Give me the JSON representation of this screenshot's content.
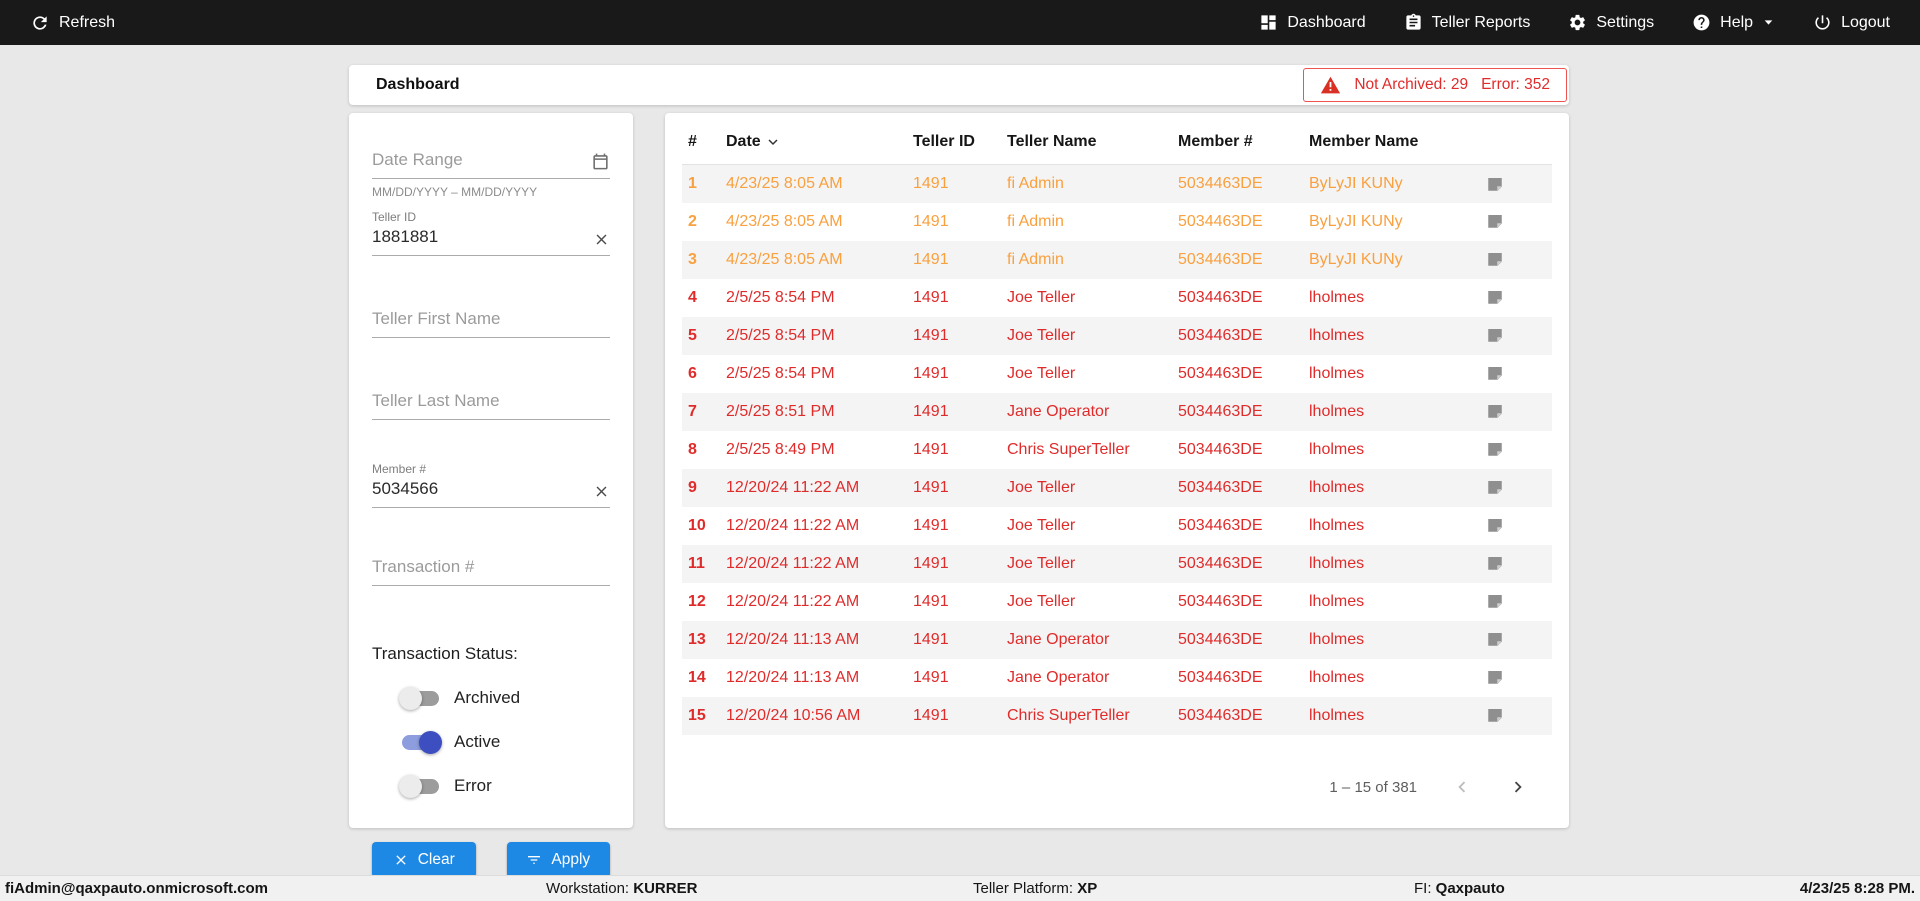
{
  "topnav": {
    "refresh_label": "Refresh",
    "dashboard": "Dashboard",
    "teller_reports": "Teller Reports",
    "settings": "Settings",
    "help": "Help",
    "logout": "Logout"
  },
  "header": {
    "title": "Dashboard",
    "alert": {
      "not_archived": "Not Archived: 29",
      "error": "Error: 352"
    }
  },
  "filters": {
    "date_range": {
      "placeholder": "Date Range",
      "hint": "MM/DD/YYYY – MM/DD/YYYY"
    },
    "teller_id": {
      "label": "Teller ID",
      "value": "1881881"
    },
    "teller_first_name": {
      "placeholder": "Teller First Name"
    },
    "teller_last_name": {
      "placeholder": "Teller Last Name"
    },
    "member_number": {
      "label": "Member #",
      "value": "5034566"
    },
    "transaction_number": {
      "placeholder": "Transaction #"
    },
    "status_label": "Transaction Status:",
    "toggles": [
      {
        "label": "Archived",
        "on": false
      },
      {
        "label": "Active",
        "on": true
      },
      {
        "label": "Error",
        "on": false
      }
    ],
    "clear_label": "Clear",
    "apply_label": "Apply"
  },
  "table": {
    "columns": [
      "#",
      "Date",
      "Teller ID",
      "Teller Name",
      "Member #",
      "Member Name"
    ],
    "sort_column": "Date",
    "sort_direction": "desc",
    "rows": [
      {
        "num": "1",
        "date": "4/23/25 8:05 AM",
        "teller_id": "1491",
        "teller_name": "fi Admin",
        "member": "5034463DE",
        "member_name": "ByLyJI KUNy",
        "status": "warning"
      },
      {
        "num": "2",
        "date": "4/23/25 8:05 AM",
        "teller_id": "1491",
        "teller_name": "fi Admin",
        "member": "5034463DE",
        "member_name": "ByLyJI KUNy",
        "status": "warning"
      },
      {
        "num": "3",
        "date": "4/23/25 8:05 AM",
        "teller_id": "1491",
        "teller_name": "fi Admin",
        "member": "5034463DE",
        "member_name": "ByLyJI KUNy",
        "status": "warning"
      },
      {
        "num": "4",
        "date": "2/5/25 8:54 PM",
        "teller_id": "1491",
        "teller_name": "Joe Teller",
        "member": "5034463DE",
        "member_name": "lholmes",
        "status": "error"
      },
      {
        "num": "5",
        "date": "2/5/25 8:54 PM",
        "teller_id": "1491",
        "teller_name": "Joe Teller",
        "member": "5034463DE",
        "member_name": "lholmes",
        "status": "error"
      },
      {
        "num": "6",
        "date": "2/5/25 8:54 PM",
        "teller_id": "1491",
        "teller_name": "Joe Teller",
        "member": "5034463DE",
        "member_name": "lholmes",
        "status": "error"
      },
      {
        "num": "7",
        "date": "2/5/25 8:51 PM",
        "teller_id": "1491",
        "teller_name": "Jane Operator",
        "member": "5034463DE",
        "member_name": "lholmes",
        "status": "error"
      },
      {
        "num": "8",
        "date": "2/5/25 8:49 PM",
        "teller_id": "1491",
        "teller_name": "Chris SuperTeller",
        "member": "5034463DE",
        "member_name": "lholmes",
        "status": "error"
      },
      {
        "num": "9",
        "date": "12/20/24 11:22 AM",
        "teller_id": "1491",
        "teller_name": "Joe Teller",
        "member": "5034463DE",
        "member_name": "lholmes",
        "status": "error"
      },
      {
        "num": "10",
        "date": "12/20/24 11:22 AM",
        "teller_id": "1491",
        "teller_name": "Joe Teller",
        "member": "5034463DE",
        "member_name": "lholmes",
        "status": "error"
      },
      {
        "num": "11",
        "date": "12/20/24 11:22 AM",
        "teller_id": "1491",
        "teller_name": "Joe Teller",
        "member": "5034463DE",
        "member_name": "lholmes",
        "status": "error"
      },
      {
        "num": "12",
        "date": "12/20/24 11:22 AM",
        "teller_id": "1491",
        "teller_name": "Joe Teller",
        "member": "5034463DE",
        "member_name": "lholmes",
        "status": "error"
      },
      {
        "num": "13",
        "date": "12/20/24 11:13 AM",
        "teller_id": "1491",
        "teller_name": "Jane Operator",
        "member": "5034463DE",
        "member_name": "lholmes",
        "status": "error"
      },
      {
        "num": "14",
        "date": "12/20/24 11:13 AM",
        "teller_id": "1491",
        "teller_name": "Jane Operator",
        "member": "5034463DE",
        "member_name": "lholmes",
        "status": "error"
      },
      {
        "num": "15",
        "date": "12/20/24 10:56 AM",
        "teller_id": "1491",
        "teller_name": "Chris SuperTeller",
        "member": "5034463DE",
        "member_name": "lholmes",
        "status": "error"
      }
    ],
    "pagination": {
      "range": "1 – 15 of 381"
    }
  },
  "footer": {
    "user": "fiAdmin@qaxpauto.onmicrosoft.com",
    "workstation_label": "Workstation:",
    "workstation": "KURRER",
    "platform_label": "Teller Platform:",
    "platform": "XP",
    "fi_label": "FI:",
    "fi": "Qaxpauto",
    "datetime": "4/23/25 8:28 PM."
  },
  "colors": {
    "warning_text": "#f9a03f",
    "error_text": "#e02b2b",
    "button_blue": "#1e88e5",
    "toggle_active": "#3c4ec0",
    "topnav_bg": "#191919"
  }
}
